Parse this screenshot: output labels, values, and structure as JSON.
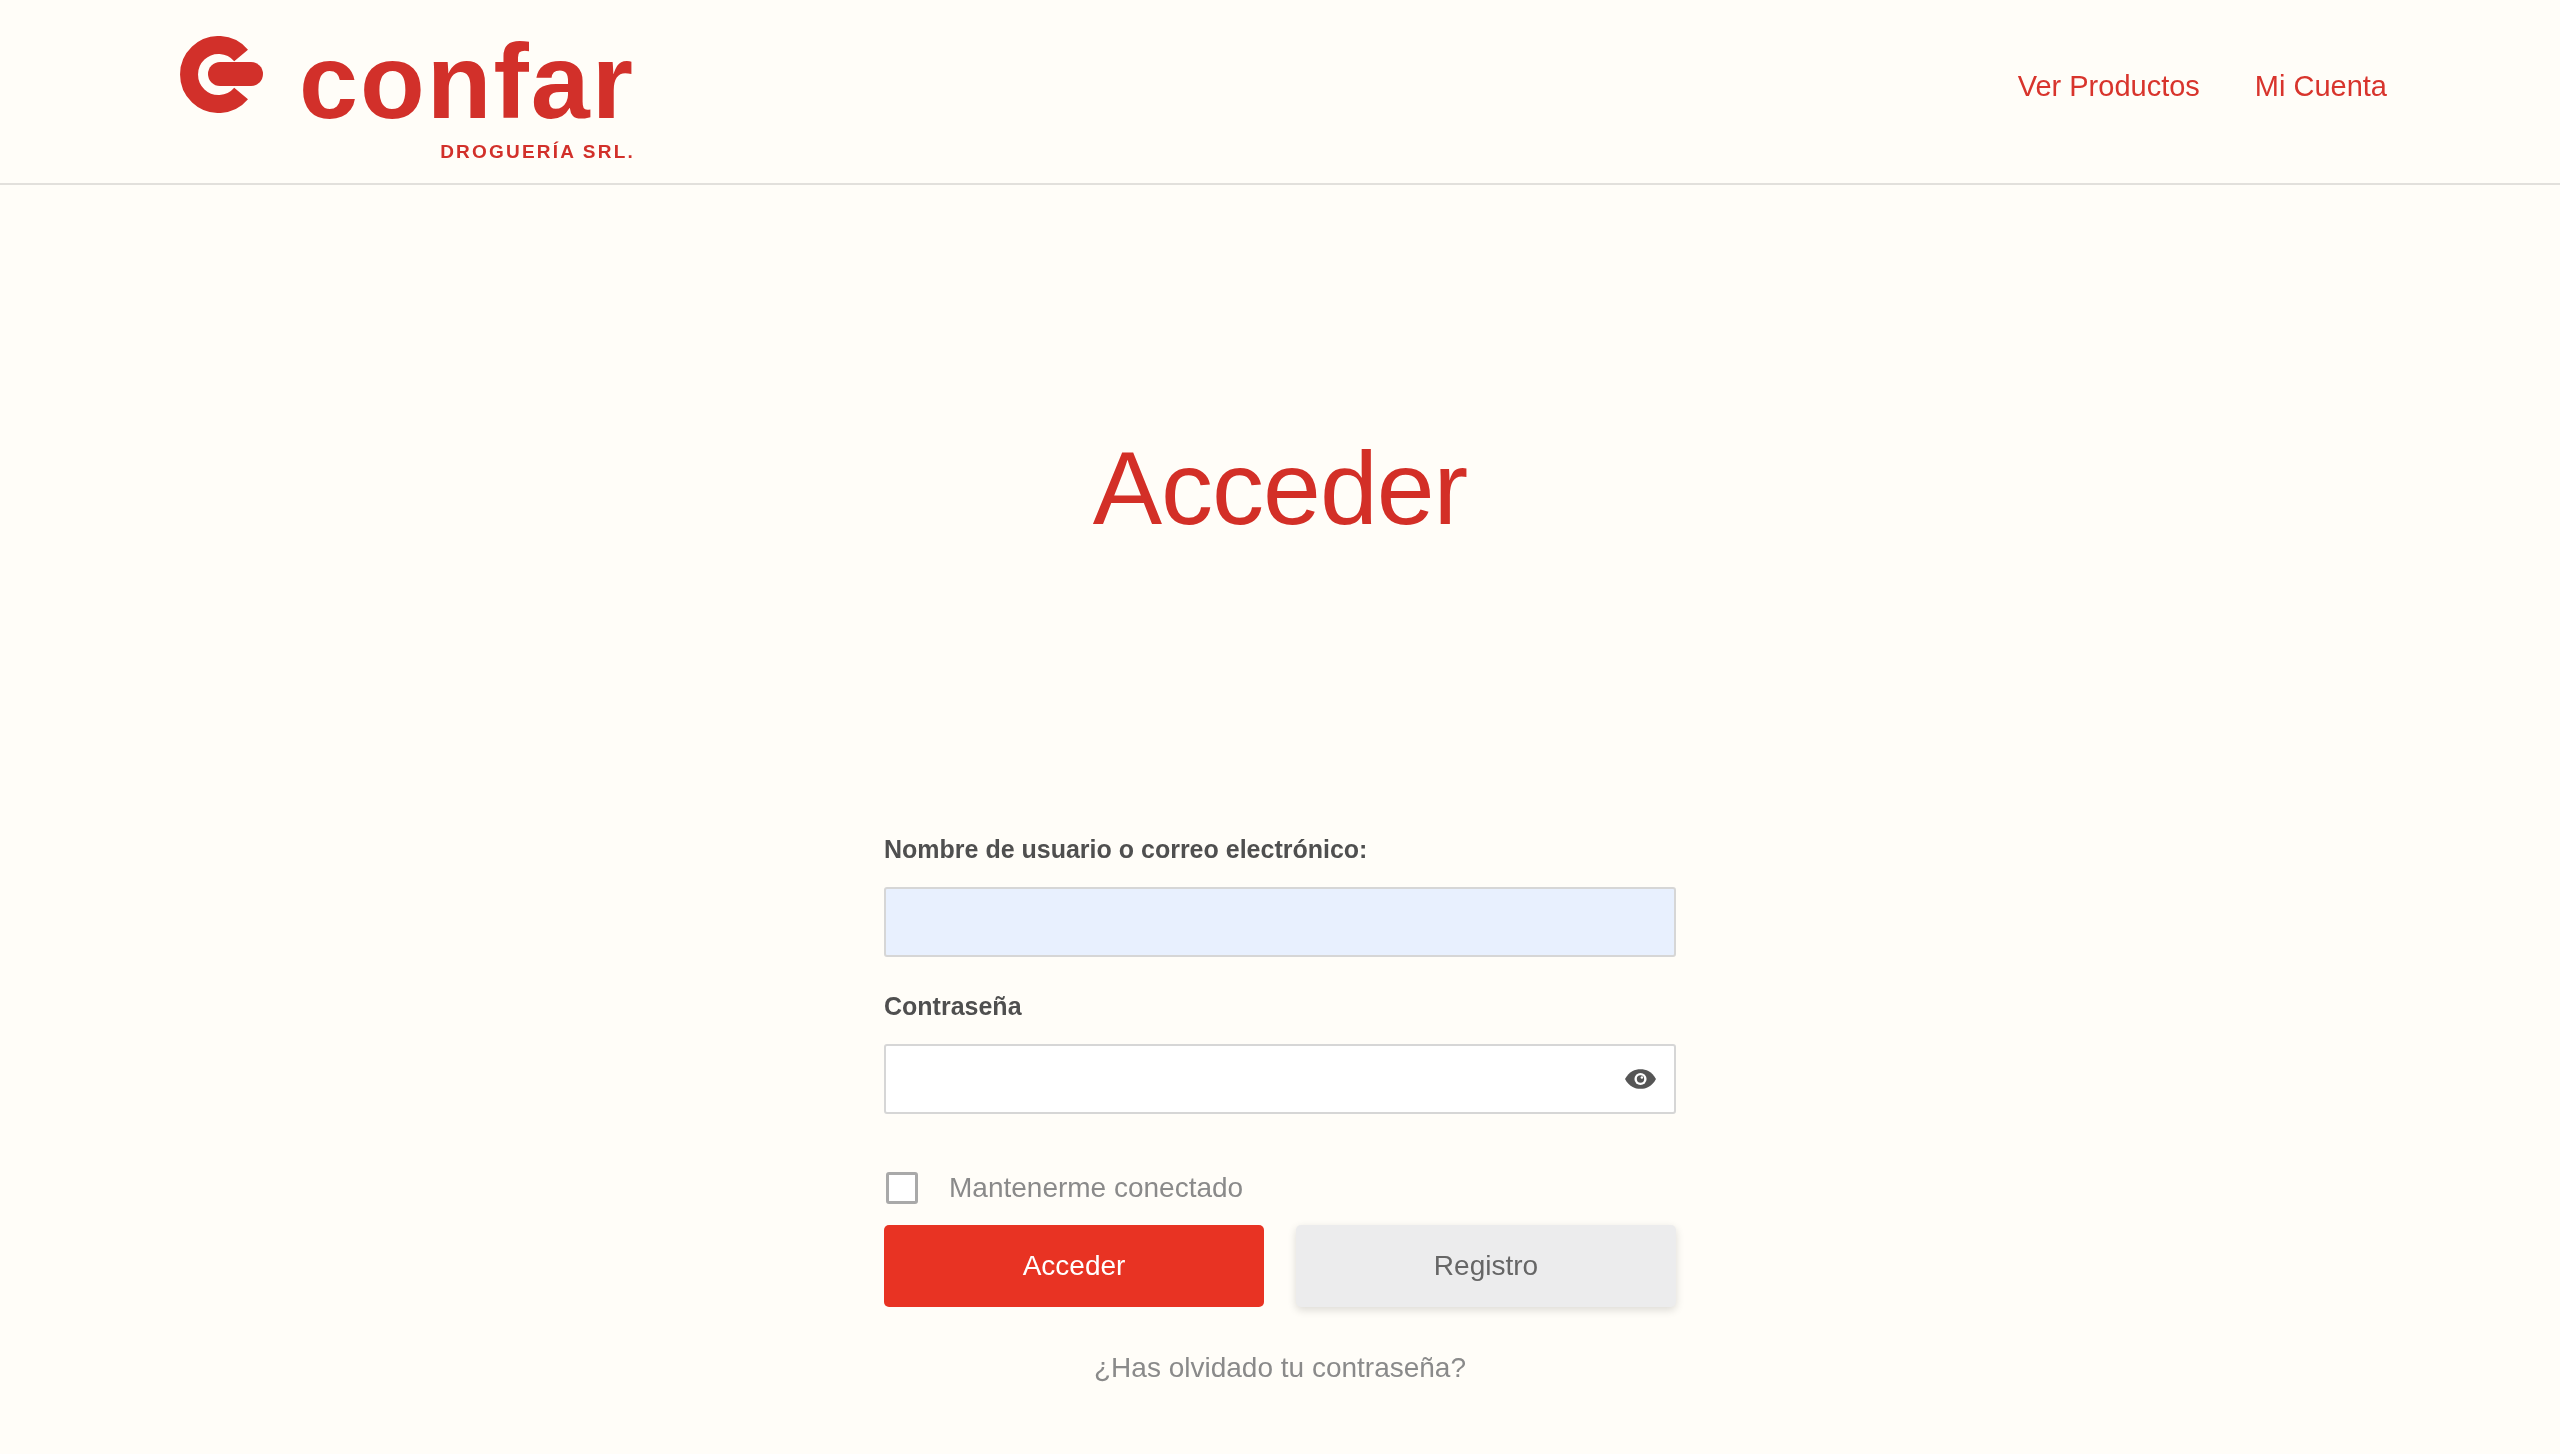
{
  "header": {
    "logo": {
      "wordmark": "confar",
      "tagline": "DROGUERÍA SRL."
    },
    "nav": [
      {
        "label": "Ver Productos"
      },
      {
        "label": "Mi Cuenta"
      }
    ]
  },
  "title": "Acceder",
  "form": {
    "fields": [
      {
        "label": "Nombre de usuario o correo electrónico:",
        "kind": "text",
        "autofilled": true
      },
      {
        "label": "Contraseña",
        "kind": "password",
        "autofilled": false
      }
    ],
    "remember": {
      "label": "Mantenerme conectado",
      "checked": false
    },
    "buttons": [
      {
        "label": "Acceder",
        "kind": "primary"
      },
      {
        "label": "Registro",
        "kind": "secondary"
      }
    ],
    "forgot_link": "¿Has olvidado tu contraseña?"
  }
}
